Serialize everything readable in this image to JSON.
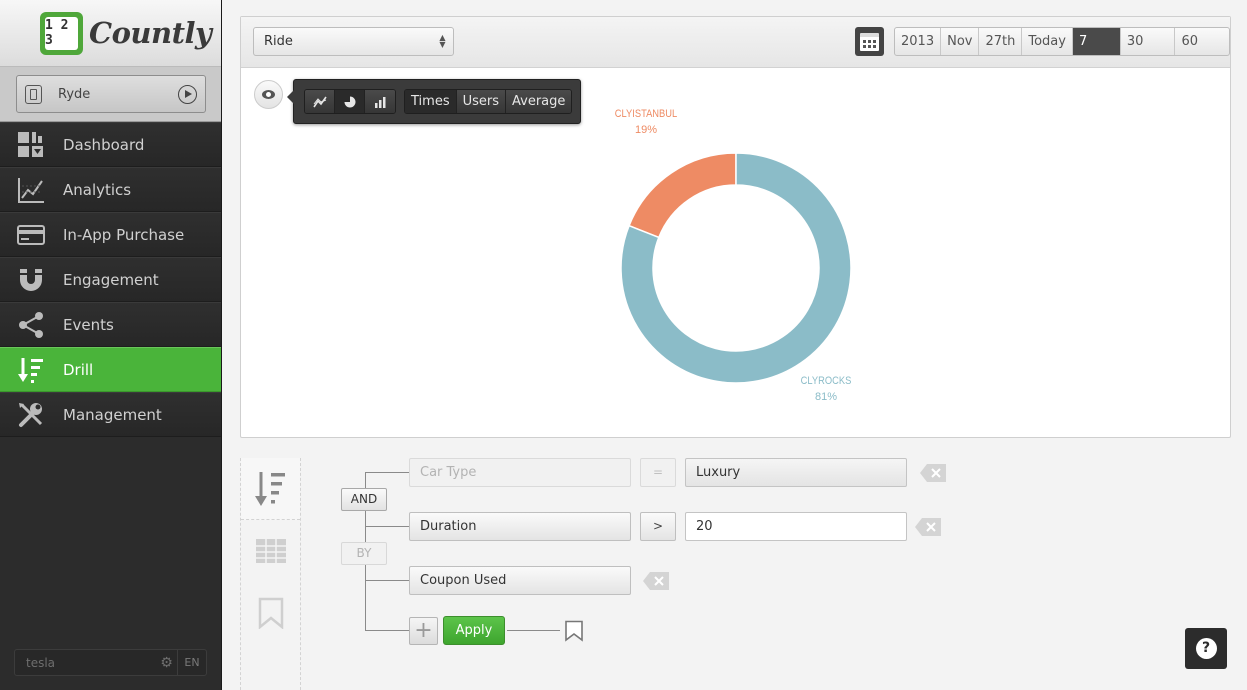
{
  "app": {
    "brand": "Countly",
    "logo_digits": "1 2 3"
  },
  "app_selector": {
    "name": "Ryde"
  },
  "nav": [
    {
      "label": "Dashboard",
      "icon": "dashboard-icon",
      "active": false
    },
    {
      "label": "Analytics",
      "icon": "analytics-icon",
      "active": false
    },
    {
      "label": "In-App Purchase",
      "icon": "credit-card-icon",
      "active": false
    },
    {
      "label": "Engagement",
      "icon": "magnet-icon",
      "active": false
    },
    {
      "label": "Events",
      "icon": "share-icon",
      "active": false
    },
    {
      "label": "Drill",
      "icon": "drill-sort-icon",
      "active": true
    },
    {
      "label": "Management",
      "icon": "tools-icon",
      "active": false
    }
  ],
  "sidebar_footer": {
    "user": "tesla",
    "language": "EN"
  },
  "header": {
    "event_select": "Ride",
    "date_tabs": [
      "2013",
      "Nov",
      "27th",
      "Today",
      "7 days",
      "30 days",
      "60 days"
    ],
    "active_date_tab": "7 days"
  },
  "chart_tools": {
    "type_buttons": [
      "line-chart-icon",
      "pie-chart-icon",
      "bar-chart-icon"
    ],
    "active_type": "pie-chart-icon",
    "metric_buttons": [
      "Times",
      "Users",
      "Average"
    ]
  },
  "chart_data": {
    "type": "pie",
    "style": "donut",
    "slices": [
      {
        "label": "CLYISTANBUL",
        "value": 19,
        "display": "19%",
        "color": "#ee8b64"
      },
      {
        "label": "CLYROCKS",
        "value": 81,
        "display": "81%",
        "color": "#8bbcc8"
      }
    ]
  },
  "query": {
    "conditions": [
      {
        "property": "Car Type",
        "operator": "=",
        "value": "Luxury",
        "disabled": true
      },
      {
        "property": "Duration",
        "operator": ">",
        "value": "20",
        "disabled": false
      }
    ],
    "logic_and": "AND",
    "logic_by": "BY",
    "by_property": "Coupon Used",
    "apply_label": "Apply",
    "add_label": "+"
  },
  "colors": {
    "accent_green": "#4ab43a",
    "sidebar_bg": "#2c2c2c"
  }
}
